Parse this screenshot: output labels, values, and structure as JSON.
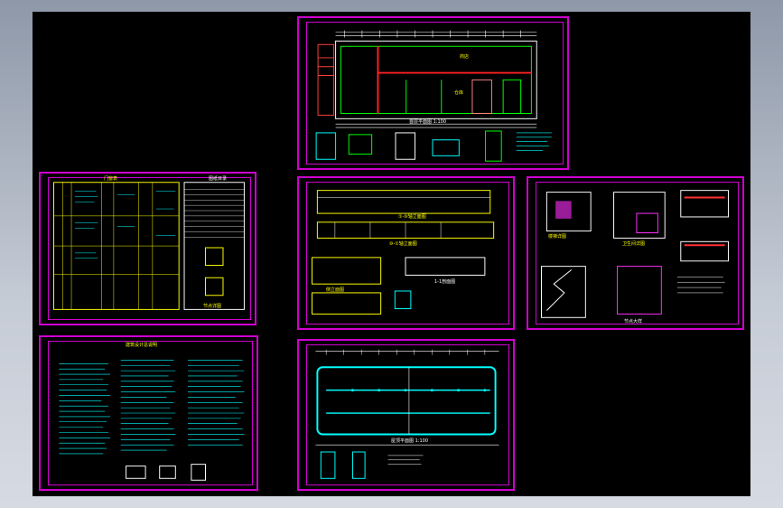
{
  "app": {
    "view": "CAD drawing set preview",
    "background": "#000000",
    "accent": "#d000d0"
  },
  "sheets": [
    {
      "id": "floor-plan",
      "labels": [
        "商店",
        "仓库",
        "首层平面图 1:100"
      ]
    },
    {
      "id": "door-window-schedule",
      "labels": [
        "门窗表",
        "图纸目录",
        "节点详图"
      ]
    },
    {
      "id": "elevations",
      "labels": [
        "①-⑩轴立面图",
        "⑩-①轴立面图",
        "侧立面图",
        "1-1剖面图"
      ]
    },
    {
      "id": "details",
      "labels": [
        "楼梯详图",
        "卫生间详图",
        "节点大样"
      ]
    },
    {
      "id": "design-notes",
      "labels": [
        "建筑设计总说明"
      ]
    },
    {
      "id": "roof-plan",
      "labels": [
        "屋顶平面图 1:100"
      ]
    }
  ]
}
